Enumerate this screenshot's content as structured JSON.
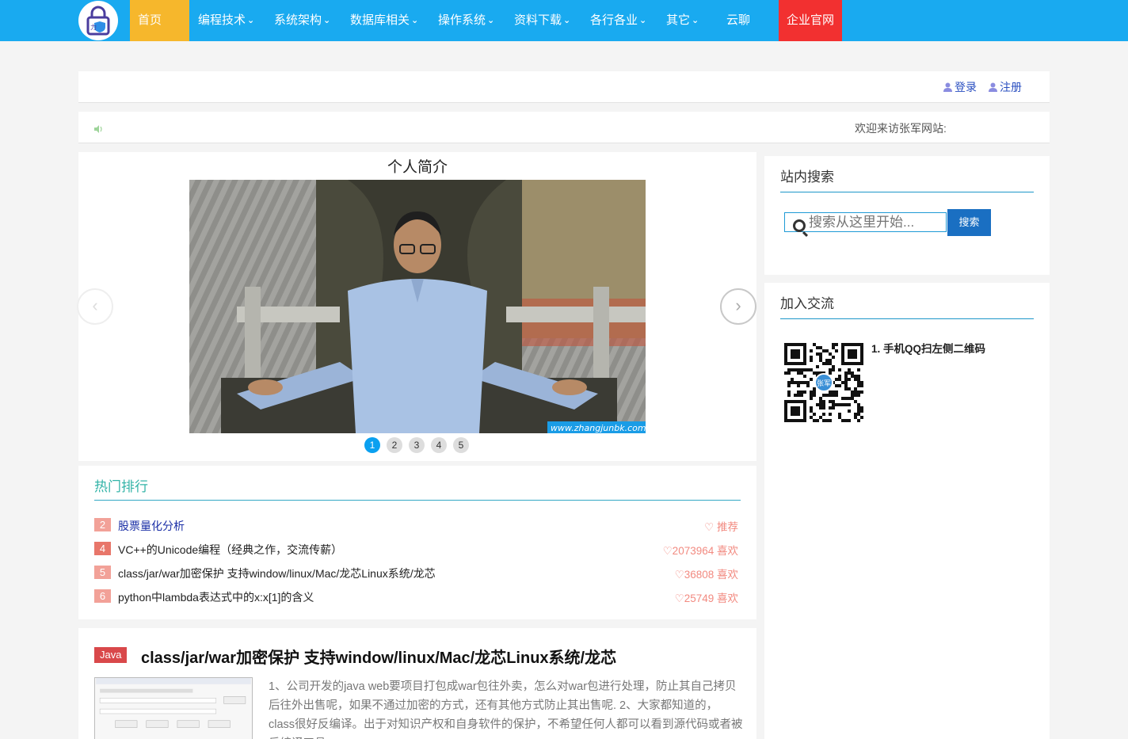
{
  "nav": {
    "items": [
      {
        "label": "首页",
        "dropdown": false
      },
      {
        "label": "编程技术",
        "dropdown": true
      },
      {
        "label": "系统架构",
        "dropdown": true
      },
      {
        "label": "数据库相关",
        "dropdown": true
      },
      {
        "label": "操作系统",
        "dropdown": true
      },
      {
        "label": "资料下载",
        "dropdown": true
      },
      {
        "label": "各行各业",
        "dropdown": true
      },
      {
        "label": "其它",
        "dropdown": true
      },
      {
        "label": "云聊",
        "dropdown": false
      },
      {
        "label": "企业官网",
        "dropdown": false
      }
    ],
    "chevron": "❯"
  },
  "userbar": {
    "login_label": "登录",
    "register_label": "注册"
  },
  "notice": {
    "welcome_text": "欢迎来访张军网站:"
  },
  "slider": {
    "title": "个人简介",
    "watermark": "www.zhangjunbk.com",
    "dots": [
      "1",
      "2",
      "3",
      "4",
      "5"
    ],
    "active_dot": 0,
    "prev": "‹",
    "next": "›"
  },
  "hot": {
    "title": "热门排行",
    "rows": [
      {
        "rank": "2",
        "text": "股票量化分析",
        "like": "♡ 推荐"
      },
      {
        "rank": "4",
        "text": "VC++的Unicode编程（经典之作，交流传薪）",
        "like": "♡2073964 喜欢"
      },
      {
        "rank": "5",
        "text": "class/jar/war加密保护 支持window/linux/Mac/龙芯Linux系统/龙芯",
        "like": "♡36808 喜欢"
      },
      {
        "rank": "6",
        "text": "python中lambda表达式中的x:x[1]的含义",
        "like": "♡25749 喜欢"
      }
    ]
  },
  "article": {
    "tag": "Java",
    "title": "class/jar/war加密保护 支持window/linux/Mac/龙芯Linux系统/龙芯",
    "summary": "1、公司开发的java web要项目打包成war包往外卖，怎么对war包进行处理，防止其自己拷贝后往外出售呢，如果不通过加密的方式，还有其他方式防止其出售呢. 2、大家都知道的，class很好反编译。出于对知识产权和自身软件的保护，不希望任何人都可以看到源代码或者被反编译工具"
  },
  "sidebar": {
    "search_title": "站内搜索",
    "search_placeholder": "搜索从这里开始...",
    "search_button": "搜索",
    "join_title": "加入交流",
    "join_tip": "1. 手机QQ扫左侧二维码",
    "qr_badge": "张军"
  },
  "colors": {
    "nav_bg": "#19aaf0",
    "home_bg": "#f6b72c",
    "corp_bg": "#f23030",
    "accent": "#1a6fc2"
  }
}
